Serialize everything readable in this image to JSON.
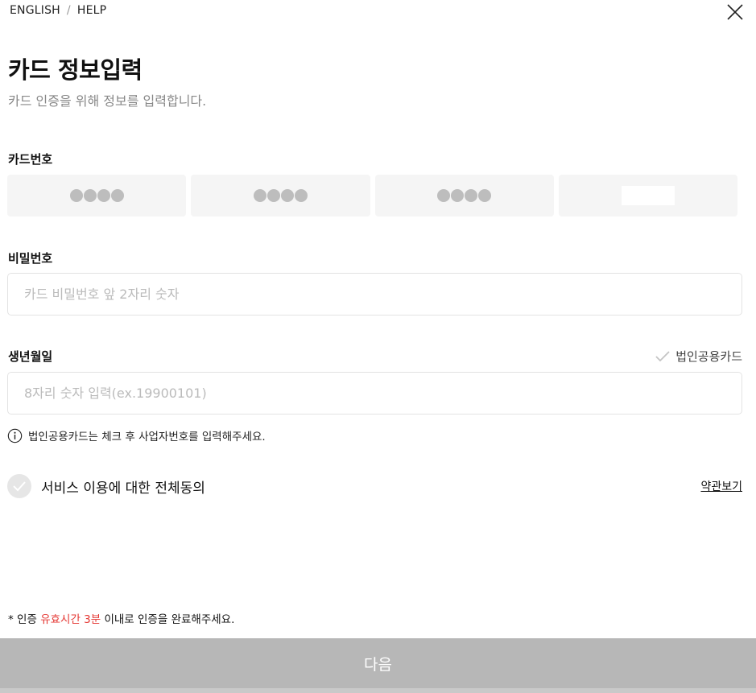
{
  "topbar": {
    "english": "ENGLISH",
    "separator": "/",
    "help": "HELP"
  },
  "header": {
    "title": "카드 정보입력",
    "subtitle": "카드 인증을 위해 정보를 입력합니다."
  },
  "card_number": {
    "label": "카드번호",
    "segments": [
      {
        "masked": true,
        "dot_count": 4
      },
      {
        "masked": true,
        "dot_count": 4
      },
      {
        "masked": true,
        "dot_count": 4
      },
      {
        "masked": false,
        "value": ""
      }
    ]
  },
  "password": {
    "label": "비밀번호",
    "placeholder": "카드 비밀번호 앞 2자리 숫자",
    "value": ""
  },
  "birthdate": {
    "label": "생년월일",
    "placeholder": "8자리 숫자 입력(ex.19900101)",
    "value": ""
  },
  "corporate_card": {
    "label": "법인공용카드",
    "checked": false
  },
  "notice": {
    "text": "법인공용카드는 체크 후 사업자번호를 입력해주세요."
  },
  "agreement": {
    "label": "서비스 이용에 대한 전체동의",
    "checked": false,
    "terms_link": "약관보기"
  },
  "footnote": {
    "prefix": "* 인증 ",
    "highlight": "유효시간 3분",
    "suffix": " 이내로 인증을 완료해주세요."
  },
  "next_button": {
    "label": "다음"
  },
  "icons": {
    "close": "close-icon",
    "check": "check-icon",
    "info": "info-icon"
  },
  "colors": {
    "highlight": "#e53935",
    "button_disabled": "#b7b7b7",
    "field_bg": "#f5f5f5",
    "dot": "#bdbdbd"
  }
}
